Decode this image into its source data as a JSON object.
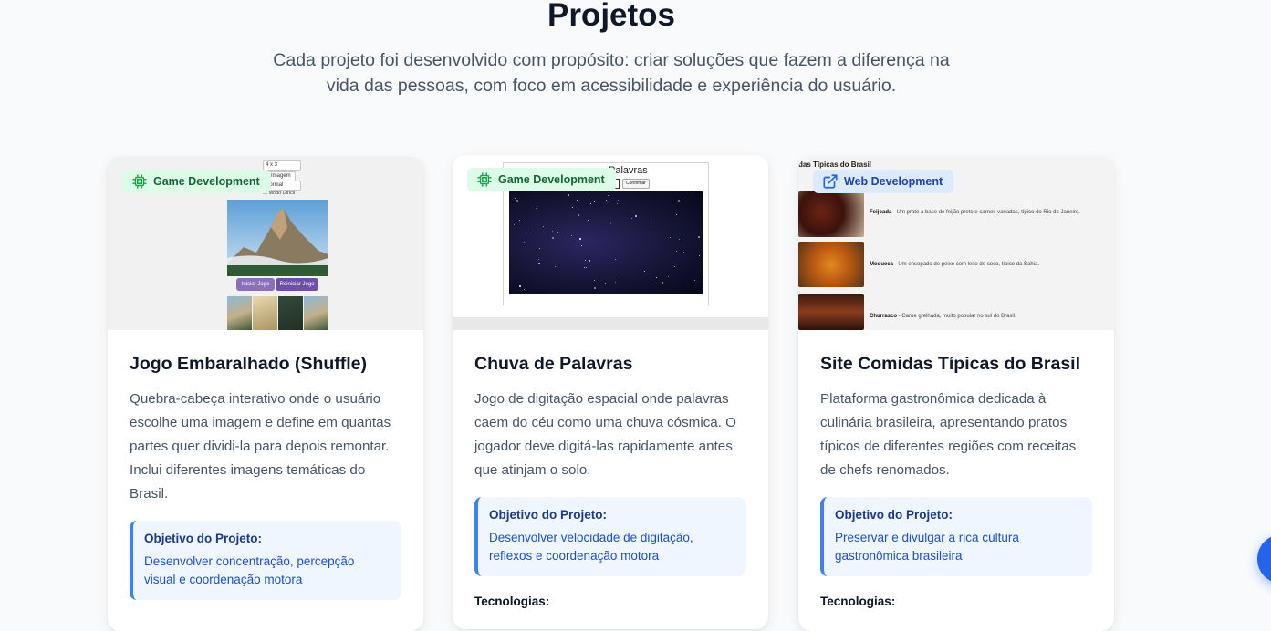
{
  "section": {
    "title": "Projetos",
    "subtitle": "Cada projeto foi desenvolvido com propósito: criar soluções que fazem a diferença na vida das pessoas, com foco em acessibilidade e experiência do usuário."
  },
  "projects": [
    {
      "badge": "Game Development",
      "badge_icon": "chip-icon",
      "title": "Jogo Embaralhado (Shuffle)",
      "description": "Quebra-cabeça interativo onde o usuário escolhe uma imagem e define em quantas partes quer dividi-la para depois remontar. Inclui diferentes imagens temáticas do Brasil.",
      "objective_label": "Objetivo do Projeto:",
      "objective": "Desenvolver concentração, percepção visual e coordenação motora",
      "preview": {
        "select_1": "4 x 3",
        "select_2": "Imagem",
        "select_3": "Normal",
        "checkbox": "Modo Difícil",
        "start_button": "Iniciar Jogo",
        "reset_button": "Reiniciar Jogo"
      }
    },
    {
      "badge": "Game Development",
      "badge_icon": "chip-icon",
      "title": "Chuva de Palavras",
      "description": "Jogo de digitação espacial onde palavras caem do céu como uma chuva cósmica. O jogador deve digitá-las rapidamente antes que atinjam o solo.",
      "objective_label": "Objetivo do Projeto:",
      "objective": "Desenvolver velocidade de digitação, reflexos e coordenação motora",
      "tech_label": "Tecnologias:",
      "preview": {
        "heading": "Palavras",
        "button": "Confirmar"
      }
    },
    {
      "badge": "Web Development",
      "badge_icon": "external-link-icon",
      "title": "Site Comidas Típicas do Brasil",
      "description": "Plataforma gastronômica dedicada à culinária brasileira, apresentando pratos típicos de diferentes regiões com receitas de chefs renomados.",
      "objective_label": "Objetivo do Projeto:",
      "objective": "Preservar e divulgar a rica cultura gastronômica brasileira",
      "tech_label": "Tecnologias:",
      "preview": {
        "heading": "das Típicas do Brasil",
        "items": [
          {
            "name": "Feijoada",
            "text": " - Um prato à base de feijão preto e carnes variadas, típico do Rio de Janeiro."
          },
          {
            "name": "Moqueca",
            "text": " - Um ensopado de peixe com leite de coco, típico da Bahia."
          },
          {
            "name": "Churrasco",
            "text": " - Carne grelhada, muito popular no sul do Brasil."
          }
        ]
      }
    }
  ],
  "colors": {
    "game_badge_bg": "#dcfce7",
    "web_badge_bg": "#dbeafe",
    "objective_accent": "#3b82f6",
    "fab": "#2563eb"
  }
}
